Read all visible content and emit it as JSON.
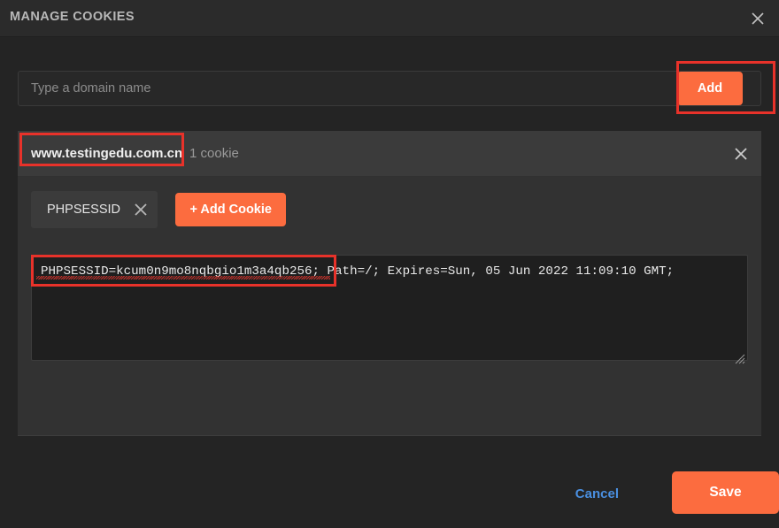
{
  "header": {
    "title": "MANAGE COOKIES",
    "close_icon": "close-x-icon"
  },
  "domain_add": {
    "input_value": "",
    "placeholder": "Type a domain name",
    "add_label": "Add"
  },
  "domain_card": {
    "domain": "www.testingedu.com.cn",
    "cookie_count_label": "1 cookie",
    "remove_icon": "close-x-icon",
    "chip": {
      "name": "PHPSESSID",
      "remove_icon": "close-x-icon"
    },
    "add_cookie_label": "+ Add Cookie",
    "cookie_value": "PHPSESSID=kcum0n9mo8nqbgio1m3a4qb256; Path=/; Expires=Sun, 05 Jun 2022 11:09:10 GMT;"
  },
  "footer": {
    "cancel_label": "Cancel",
    "save_label": "Save"
  },
  "colors": {
    "accent_orange": "#fc6c3f",
    "link_blue": "#4a8fe0",
    "annotation_red": "#e8322a",
    "panel_bg": "#242424",
    "card_bg": "#323232",
    "card_header_bg": "#3b3b3b",
    "textarea_bg": "#1f1f1f"
  }
}
